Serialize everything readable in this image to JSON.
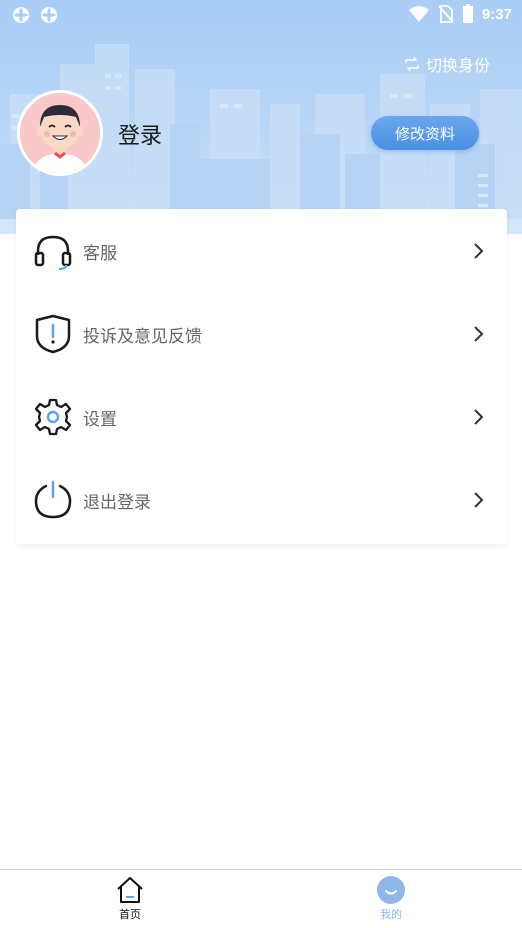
{
  "status_bar": {
    "time": "9:37",
    "left_icons": [
      "notification-icon",
      "notification-icon"
    ],
    "right_icons": [
      "wifi-icon",
      "no-sim-icon",
      "battery-icon"
    ]
  },
  "header": {
    "switch_label": "切换身份",
    "switch_icon": "swap-icon",
    "login_label": "登录",
    "edit_profile_label": "修改资料"
  },
  "menu": {
    "items": [
      {
        "label": "客服",
        "icon": "headset-icon"
      },
      {
        "label": "投诉及意见反馈",
        "icon": "shield-alert-icon"
      },
      {
        "label": "设置",
        "icon": "gear-icon"
      },
      {
        "label": "退出登录",
        "icon": "power-icon"
      }
    ]
  },
  "bottom_nav": {
    "items": [
      {
        "label": "首页",
        "icon": "home-icon",
        "active": false
      },
      {
        "label": "我的",
        "icon": "profile-icon",
        "active": true
      }
    ]
  },
  "colors": {
    "accent": "#4a8fe2",
    "header_bg": "#a9cdf5",
    "active_nav": "#8fb8ea",
    "menu_text": "#666666"
  }
}
